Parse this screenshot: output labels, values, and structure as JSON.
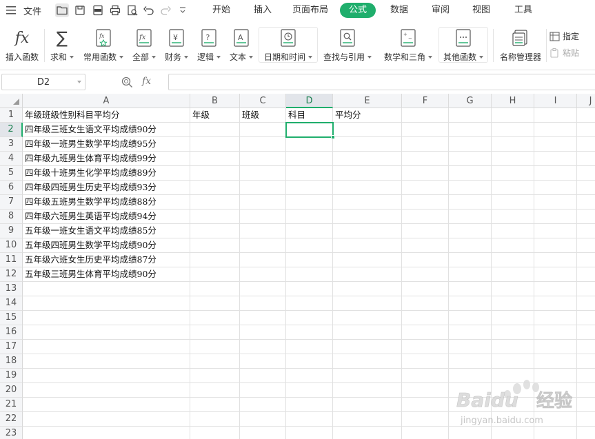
{
  "menubar": {
    "file_label": "文件",
    "tabs": [
      "开始",
      "插入",
      "页面布局",
      "公式",
      "数据",
      "审阅",
      "视图",
      "工具"
    ],
    "active_tab": "公式",
    "accent_color": "#1fae6c"
  },
  "ribbon": {
    "insert_function": "插入函数",
    "fx_glyph": "fx",
    "autosum": "求和",
    "common_functions": "常用函数",
    "all_functions": "全部",
    "financial": "财务",
    "logical": "逻辑",
    "text": "文本",
    "date_time": "日期和时间",
    "lookup_reference": "查找与引用",
    "math_trig": "数学和三角",
    "more_functions": "其他函数",
    "name_manager": "名称管理器",
    "specify": "指定",
    "paste": "粘贴"
  },
  "formula_bar": {
    "name_box": "D2",
    "fx_label": "fx",
    "formula": ""
  },
  "sheet": {
    "columns": [
      "A",
      "B",
      "C",
      "D",
      "E",
      "F",
      "G",
      "H",
      "I",
      "J"
    ],
    "rows": [
      "1",
      "2",
      "3",
      "4",
      "5",
      "6",
      "7",
      "8",
      "9",
      "10",
      "11",
      "12",
      "13",
      "14",
      "15",
      "16",
      "17",
      "18",
      "19",
      "20",
      "21",
      "22",
      "23"
    ],
    "selected_cell": "D2",
    "selected_column": "D",
    "selected_row": "2",
    "cells": {
      "A1": "年级班级性别科目平均分",
      "B1": "年级",
      "C1": "班级",
      "D1": "科目",
      "E1": "平均分",
      "A2": "四年级三班女生语文平均成绩90分",
      "A3": "四年级一班男生数学平均成绩95分",
      "A4": "四年级九班男生体育平均成绩99分",
      "A5": "四年级十班男生化学平均成绩89分",
      "A6": "四年级四班男生历史平均成绩93分",
      "A7": "四年级五班男生数学平均成绩88分",
      "A8": "四年级六班男生英语平均成绩94分",
      "A9": "五年级一班女生语文平均成绩85分",
      "A10": "五年级四班男生数学平均成绩90分",
      "A11": "五年级六班女生历史平均成绩87分",
      "A12": "五年级三班男生体育平均成绩90分"
    }
  },
  "watermark": {
    "brand": "Baidu",
    "brand_cn": "经验",
    "url": "jingyan.baidu.com"
  }
}
